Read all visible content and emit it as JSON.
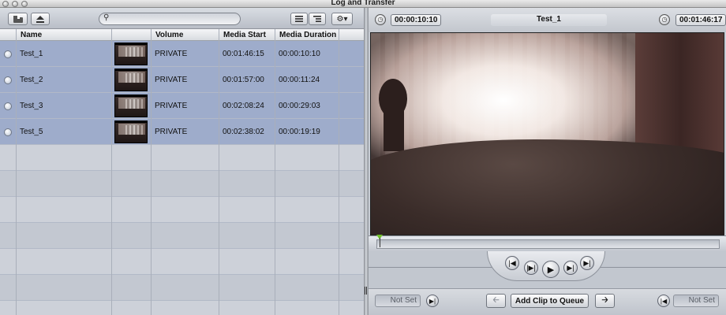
{
  "window": {
    "title": "Log and Transfer"
  },
  "columns": [
    "Name",
    "",
    "Volume",
    "Media Start",
    "Media Duration"
  ],
  "clips": [
    {
      "name": "Test_1",
      "volume": "PRIVATE",
      "media_start": "00:01:46:15",
      "media_duration": "00:00:10:10"
    },
    {
      "name": "Test_2",
      "volume": "PRIVATE",
      "media_start": "00:01:57:00",
      "media_duration": "00:00:11:24"
    },
    {
      "name": "Test_3",
      "volume": "PRIVATE",
      "media_start": "00:02:08:24",
      "media_duration": "00:00:29:03"
    },
    {
      "name": "Test_5",
      "volume": "PRIVATE",
      "media_start": "00:02:38:02",
      "media_duration": "00:00:19:19"
    }
  ],
  "viewer": {
    "duration_timecode": "00:00:10:10",
    "clip_name": "Test_1",
    "current_timecode": "00:01:46:17"
  },
  "bottom": {
    "in_point": "Not Set",
    "out_point": "Not Set",
    "add_clip_label": "Add Clip to Queue"
  },
  "icons": {
    "import": "folder-import-icon",
    "eject": "eject-icon",
    "search": "search-icon",
    "list_view": "list-view-icon",
    "outline_view": "outline-view-icon",
    "action": "gear-icon"
  }
}
